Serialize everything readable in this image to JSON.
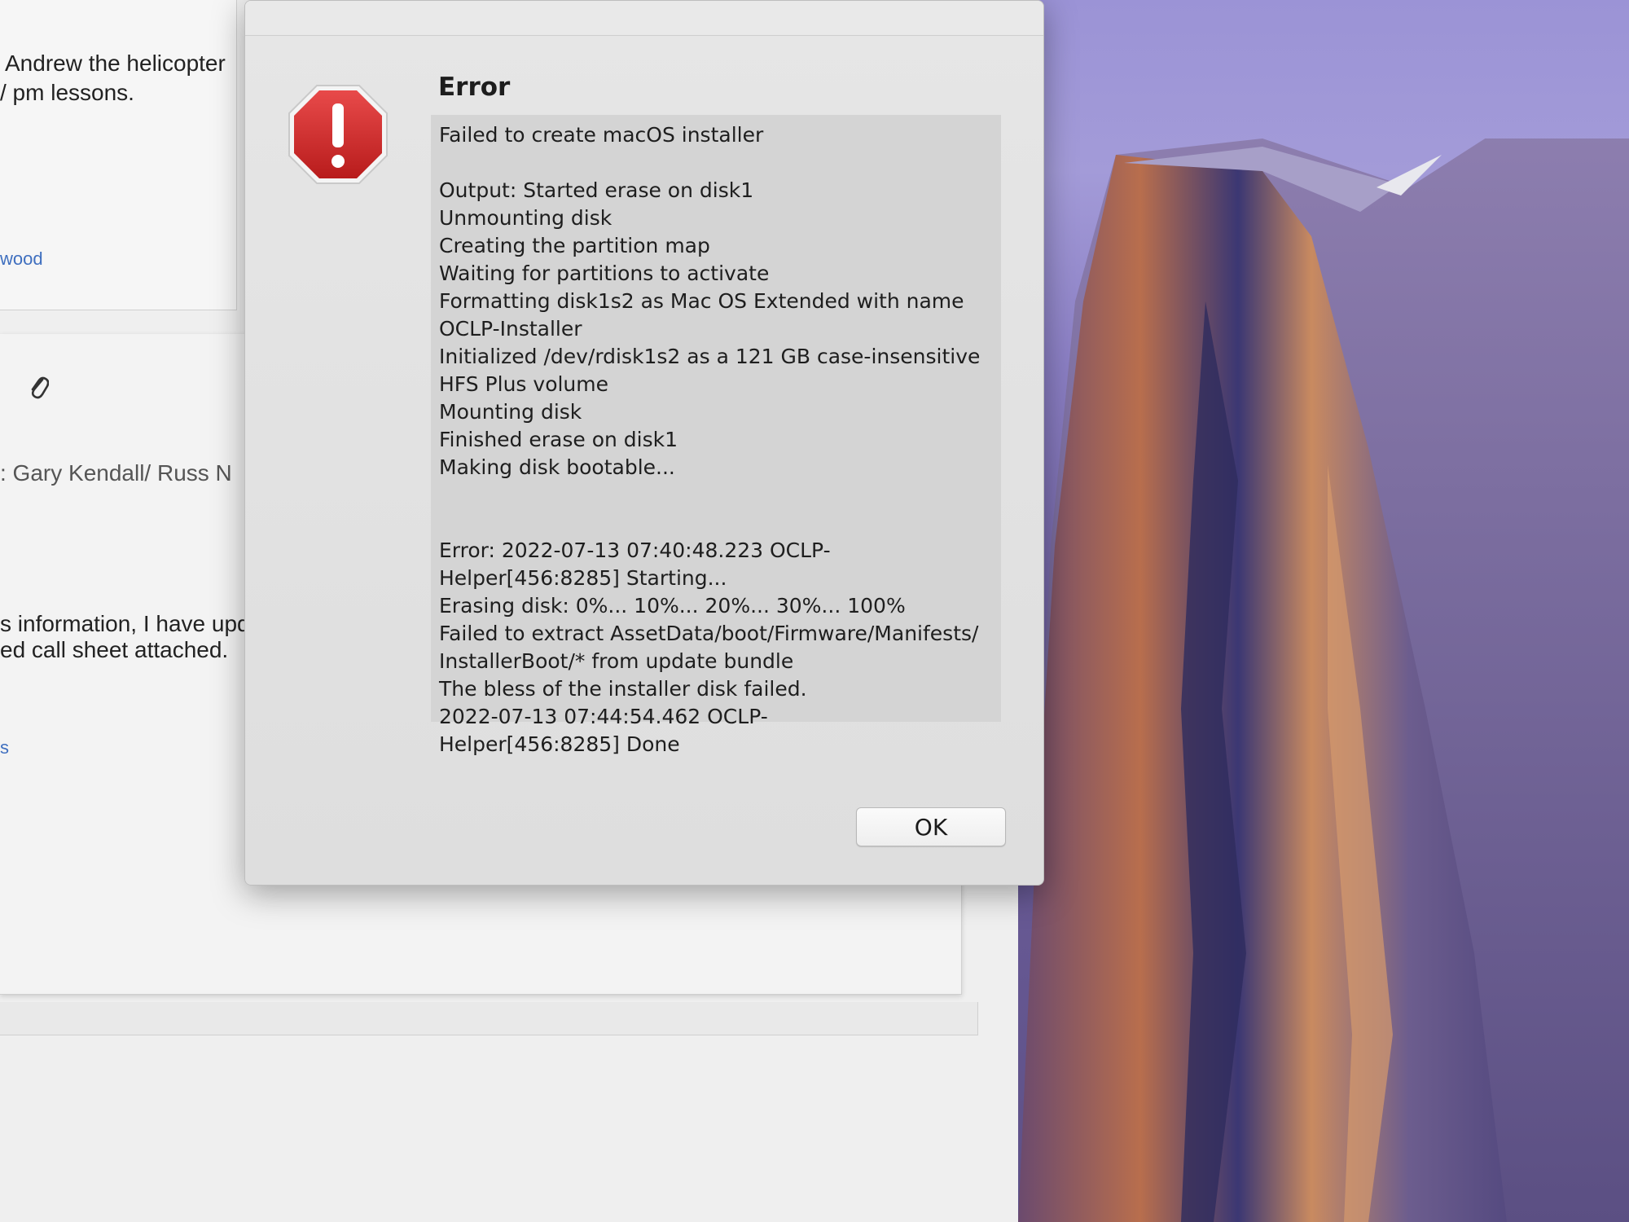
{
  "mail": {
    "line_1": "Andrew the helicopter",
    "line_2": "/ pm lessons.",
    "link_1": "wood",
    "recipients": ": Gary Kendall/ Russ N",
    "body_1": "s information, I have upd",
    "body_2": "ed call sheet attached.",
    "link_2": "s",
    "attachment_icon": "paperclip-icon"
  },
  "alert": {
    "icon": "stop-icon",
    "icon_color": "#d42a2a",
    "title": "Error",
    "message_lines": [
      "Failed to create macOS installer",
      "",
      "Output: Started erase on disk1",
      "Unmounting disk",
      "Creating the partition map",
      "Waiting for partitions to activate",
      "Formatting disk1s2 as Mac OS Extended with name",
      "OCLP-Installer",
      "Initialized /dev/rdisk1s2 as a 121 GB case-insensitive",
      "HFS Plus volume",
      "Mounting disk",
      "Finished erase on disk1",
      "Making disk bootable...",
      "",
      "",
      "Error: 2022-07-13 07:40:48.223 OCLP-",
      "Helper[456:8285] Starting...",
      "Erasing disk: 0%... 10%... 20%... 30%... 100%",
      "Failed to extract AssetData/boot/Firmware/Manifests/",
      "InstallerBoot/* from update bundle",
      "The bless of the installer disk failed.",
      "2022-07-13 07:44:54.462 OCLP-",
      "Helper[456:8285] Done"
    ],
    "ok_label": "OK"
  }
}
